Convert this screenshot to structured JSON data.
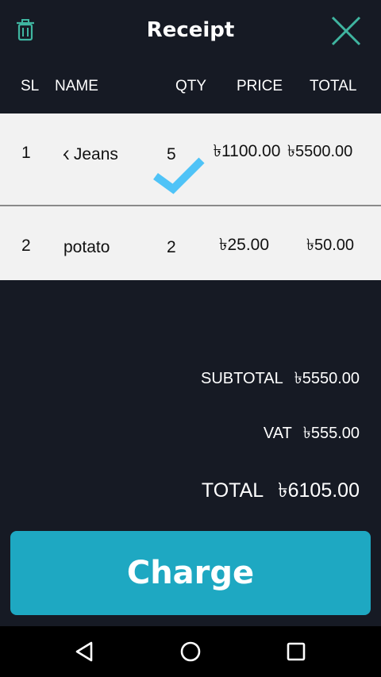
{
  "header": {
    "title": "Receipt",
    "delete_icon": "trash-icon",
    "close_icon": "close-icon"
  },
  "columns": {
    "sl": "SL",
    "name": "NAME",
    "qty": "QTY",
    "price": "PRICE",
    "total": "TOTAL"
  },
  "items": [
    {
      "sl": "1",
      "name": "Black Jeans",
      "visible_name": "ck Jeans",
      "qty": "5",
      "price": "৳1100.00",
      "total": "৳5500.00"
    },
    {
      "sl": "2",
      "name": "potato",
      "visible_name": "potato",
      "qty": "2",
      "price": "৳25.00",
      "total": "৳50.00"
    }
  ],
  "swipe_confirm_icon": "checkmark-icon",
  "totals": {
    "subtotal_label": "SUBTOTAL",
    "subtotal_value": "৳5550.00",
    "vat_label": "VAT",
    "vat_value": "৳555.00",
    "total_label": "TOTAL",
    "total_value": "৳6105.00"
  },
  "charge_label": "Charge",
  "colors": {
    "background": "#161a24",
    "accent": "#1ea8c2",
    "checkmark": "#4fc3f7",
    "close_icon": "#3fb5a0"
  },
  "navbar": {
    "back_icon": "back-triangle-icon",
    "home_icon": "home-circle-icon",
    "recents_icon": "recents-square-icon"
  }
}
